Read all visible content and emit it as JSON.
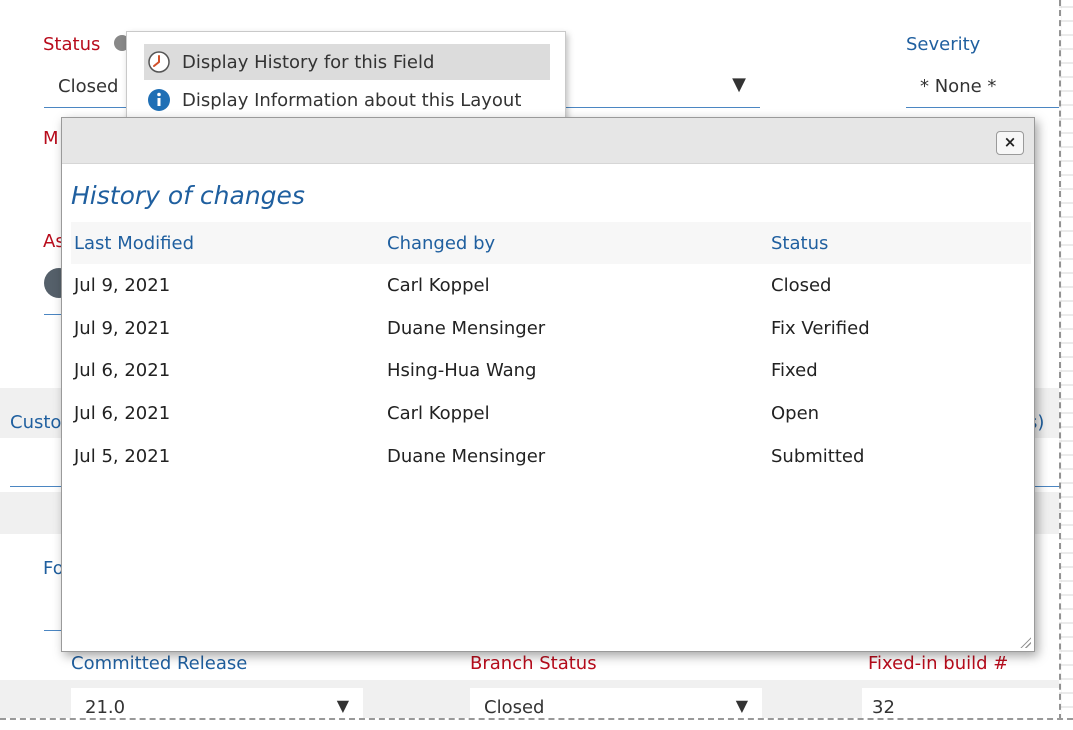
{
  "background_form": {
    "status_label": "Status",
    "status_value": "Closed",
    "severity_label": "Severity",
    "severity_value": "* None *",
    "committed_release_label": "Committed Release",
    "committed_release_value": "21.0",
    "branch_status_label": "Branch Status",
    "branch_status_value": "Closed",
    "fixed_in_build_label": "Fixed-in build #",
    "fixed_in_build_value": "32",
    "partial_labels": {
      "m": "M",
      "as": "As",
      "custo": "Custo",
      "fo": "Fo",
      "s_paren": "s)"
    }
  },
  "context_menu": {
    "items": [
      {
        "label": "Display History for this Field",
        "icon": "history-clock-icon",
        "highlighted": true
      },
      {
        "label": "Display Information about this Layout",
        "icon": "info-icon",
        "highlighted": false
      }
    ]
  },
  "dialog": {
    "close_label": "×",
    "title": "History of changes",
    "columns": [
      "Last Modified",
      "Changed by",
      "Status"
    ],
    "rows": [
      [
        "Jul 9, 2021",
        "Carl Koppel",
        "Closed"
      ],
      [
        "Jul 9, 2021",
        "Duane Mensinger",
        "Fix Verified"
      ],
      [
        "Jul 6, 2021",
        "Hsing-Hua Wang",
        "Fixed"
      ],
      [
        "Jul 6, 2021",
        "Carl Koppel",
        "Open"
      ],
      [
        "Jul 5, 2021",
        "Duane Mensinger",
        "Submitted"
      ]
    ]
  },
  "colors": {
    "accent_blue": "#1f5f9f",
    "required_red": "#b80c1c",
    "header_gray": "#e6e6e6",
    "highlight_gray": "#dcdcdc"
  }
}
